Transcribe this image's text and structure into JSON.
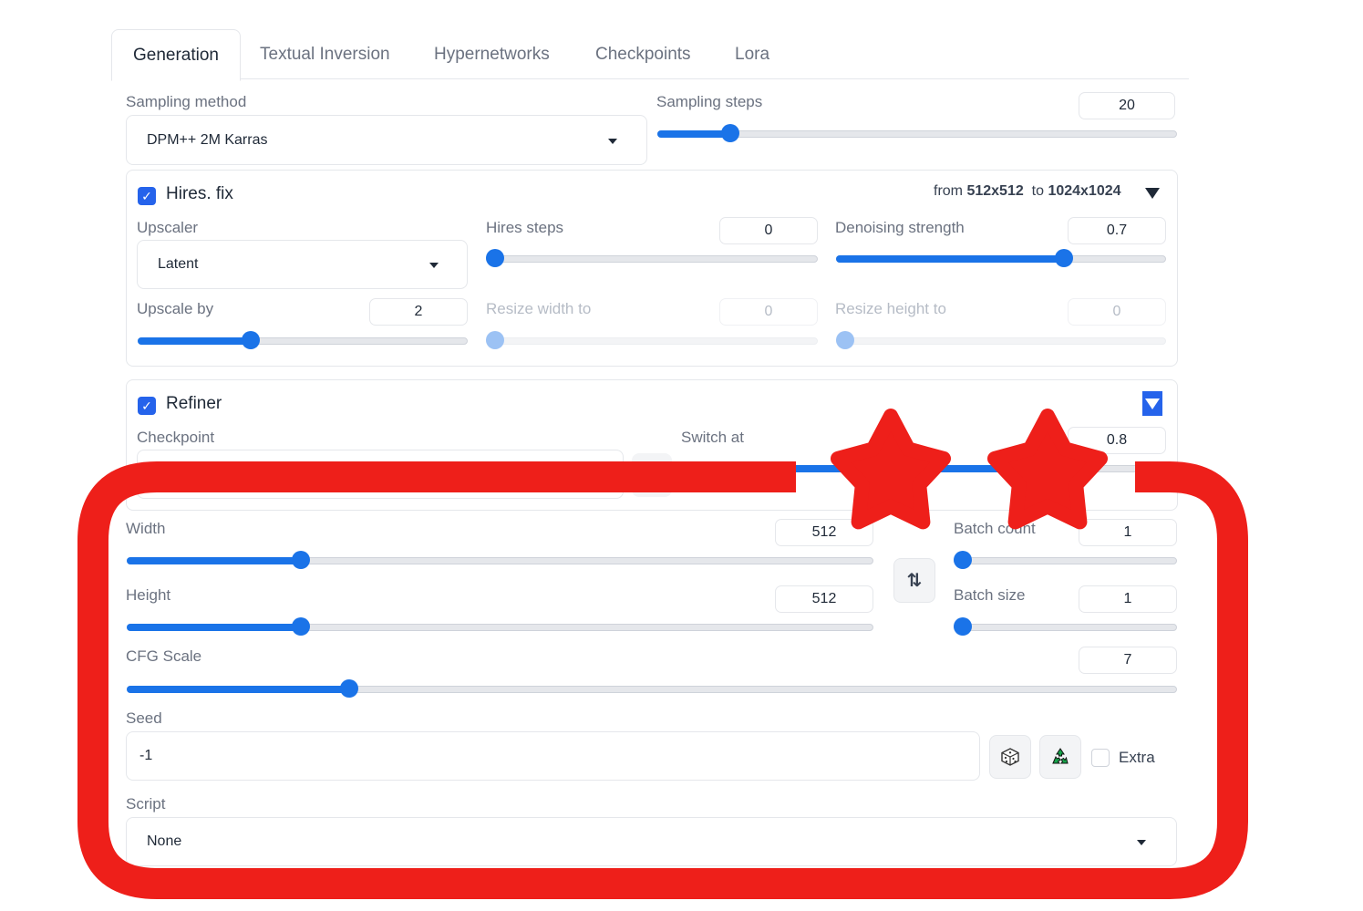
{
  "tabs": [
    "Generation",
    "Textual Inversion",
    "Hypernetworks",
    "Checkpoints",
    "Lora"
  ],
  "sampling": {
    "method_label": "Sampling method",
    "method_value": "DPM++ 2M Karras",
    "steps_label": "Sampling steps",
    "steps_value": "20",
    "steps_fraction": 0.13
  },
  "hires": {
    "label": "Hires. fix",
    "from_prefix": "from",
    "from_size": "512x512",
    "to_prefix": "to",
    "to_size": "1024x1024",
    "upscaler_label": "Upscaler",
    "upscaler_value": "Latent",
    "hires_steps_label": "Hires steps",
    "hires_steps_value": "0",
    "denoising_label": "Denoising strength",
    "denoising_value": "0.7",
    "upscale_by_label": "Upscale by",
    "upscale_by_value": "2",
    "resize_width_label": "Resize width to",
    "resize_width_value": "0",
    "resize_height_label": "Resize height to",
    "resize_height_value": "0"
  },
  "refiner": {
    "label": "Refiner",
    "checkpoint_label": "Checkpoint",
    "switch_label": "Switch at",
    "switch_value": "0.8"
  },
  "dims": {
    "width_label": "Width",
    "width_value": "512",
    "height_label": "Height",
    "height_value": "512",
    "batch_count_label": "Batch count",
    "batch_count_value": "1",
    "batch_size_label": "Batch size",
    "batch_size_value": "1",
    "swap_icon": "⇅"
  },
  "cfg": {
    "label": "CFG Scale",
    "value": "7"
  },
  "seed": {
    "label": "Seed",
    "value": "-1",
    "extra_label": "Extra"
  },
  "script": {
    "label": "Script",
    "value": "None"
  },
  "colors": {
    "accent": "#1a73e8",
    "highlight": "#ee1f1a"
  }
}
